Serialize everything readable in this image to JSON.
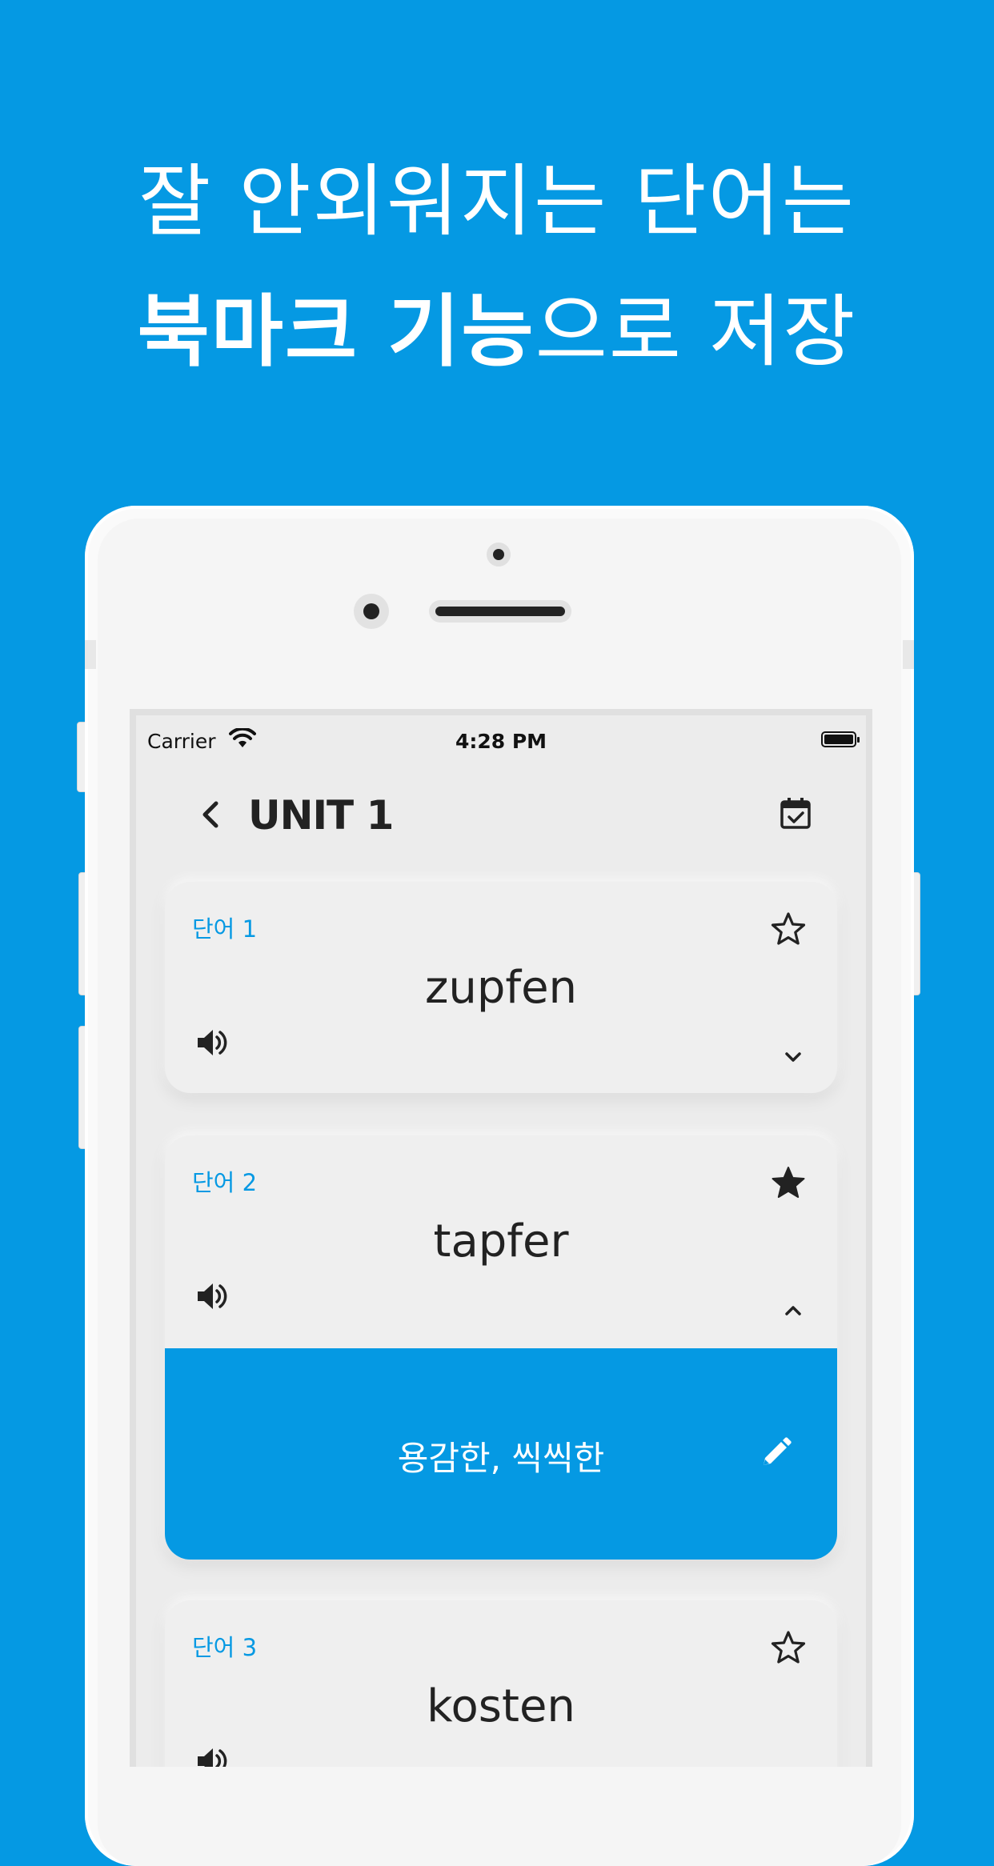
{
  "headline": {
    "line1": "잘 안외워지는 단어는",
    "line2_bold": "북마크 기능",
    "line2_rest": "으로 저장"
  },
  "status_bar": {
    "carrier": "Carrier",
    "time": "4:28 PM"
  },
  "nav": {
    "title": "UNIT 1"
  },
  "cards": [
    {
      "label": "단어 1",
      "word": "zupfen",
      "bookmarked": false,
      "expanded": false
    },
    {
      "label": "단어 2",
      "word": "tapfer",
      "bookmarked": true,
      "expanded": true,
      "meaning": "용감한, 씩씩한"
    },
    {
      "label": "단어 3",
      "word": "kosten",
      "bookmarked": false,
      "expanded": false
    }
  ],
  "colors": {
    "background": "#0599e3",
    "accent": "#0599e3",
    "card": "#efefef",
    "text": "#222222"
  },
  "icons": {
    "back": "chevron-left-icon",
    "calendar": "calendar-check-icon",
    "bookmark_empty": "star-outline-icon",
    "bookmark_filled": "star-filled-icon",
    "audio": "speaker-icon",
    "expand": "chevron-down-icon",
    "collapse": "chevron-up-icon",
    "edit": "pencil-icon"
  }
}
